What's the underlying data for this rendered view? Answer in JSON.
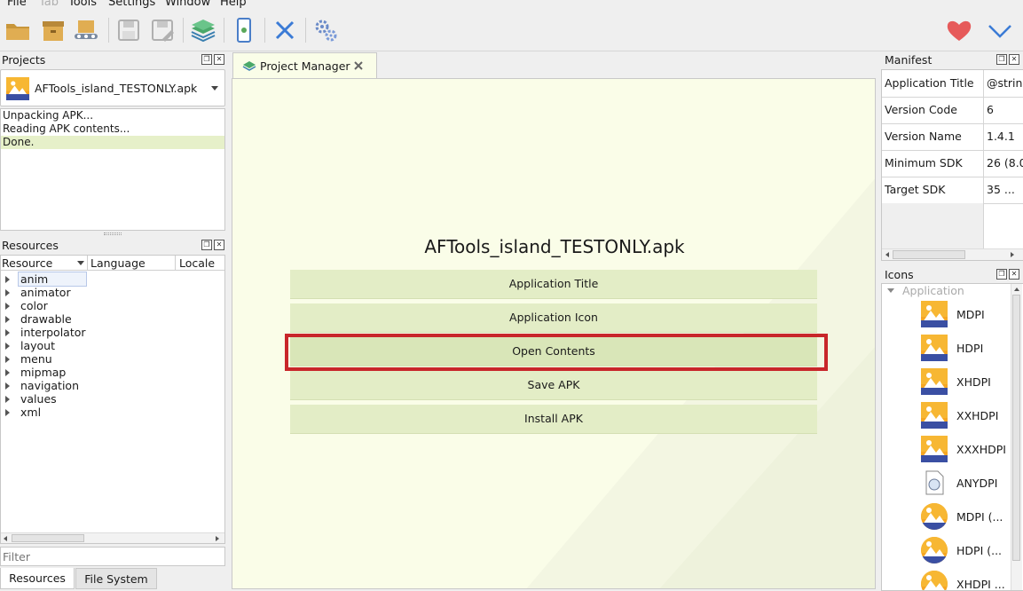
{
  "menubar": {
    "items": [
      {
        "label": "File",
        "enabled": true
      },
      {
        "label": "Tab",
        "enabled": false
      },
      {
        "label": "Tools",
        "enabled": true
      },
      {
        "label": "Settings",
        "enabled": true
      },
      {
        "label": "Window",
        "enabled": true
      },
      {
        "label": "Help",
        "enabled": true
      }
    ]
  },
  "toolbar": {
    "icons": [
      "open-folder-icon",
      "open-archive-icon",
      "conveyor-icon",
      "save-icon",
      "save-as-icon",
      "layers-icon",
      "device-icon",
      "close-x-icon",
      "settings-gears-icon"
    ],
    "right_icons": [
      "heart-icon",
      "chevron-down-icon"
    ],
    "colors": {
      "heart": "#e65a5a",
      "chevron": "#3b7bd6",
      "cross": "#3b7bd6"
    }
  },
  "projects": {
    "title": "Projects",
    "selected_project": "AFTools_island_TESTONLY.apk",
    "log": [
      "Unpacking APK...",
      "Reading APK contents...",
      "Done."
    ]
  },
  "resources": {
    "title": "Resources",
    "columns": [
      "Resource",
      "Language",
      "Locale"
    ],
    "items": [
      "anim",
      "animator",
      "color",
      "drawable",
      "interpolator",
      "layout",
      "menu",
      "mipmap",
      "navigation",
      "values",
      "xml"
    ],
    "filter_placeholder": "Filter",
    "tabs": [
      "Resources",
      "File System"
    ]
  },
  "center": {
    "tab_label": "Project Manager",
    "apk_title": "AFTools_island_TESTONLY.apk",
    "buttons": [
      "Application Title",
      "Application Icon",
      "Open Contents",
      "Save APK",
      "Install APK"
    ],
    "highlight_color": "#c8262a"
  },
  "manifest": {
    "title": "Manifest",
    "rows": [
      {
        "key": "Application Title",
        "value": "@strin"
      },
      {
        "key": "Version Code",
        "value": "6"
      },
      {
        "key": "Version Name",
        "value": "1.4.1"
      },
      {
        "key": "Minimum SDK",
        "value": "26 (8.0"
      },
      {
        "key": "Target SDK",
        "value": "35 ..."
      }
    ]
  },
  "icons": {
    "title": "Icons",
    "group": "Application",
    "items": [
      {
        "label": "MDPI",
        "kind": "square"
      },
      {
        "label": "HDPI",
        "kind": "square"
      },
      {
        "label": "XHDPI",
        "kind": "square"
      },
      {
        "label": "XXHDPI",
        "kind": "square"
      },
      {
        "label": "XXXHDPI",
        "kind": "square"
      },
      {
        "label": "ANYDPI",
        "kind": "file"
      },
      {
        "label": "MDPI (...",
        "kind": "round"
      },
      {
        "label": "HDPI (...",
        "kind": "round"
      },
      {
        "label": "XHDPI ...",
        "kind": "round"
      }
    ]
  }
}
